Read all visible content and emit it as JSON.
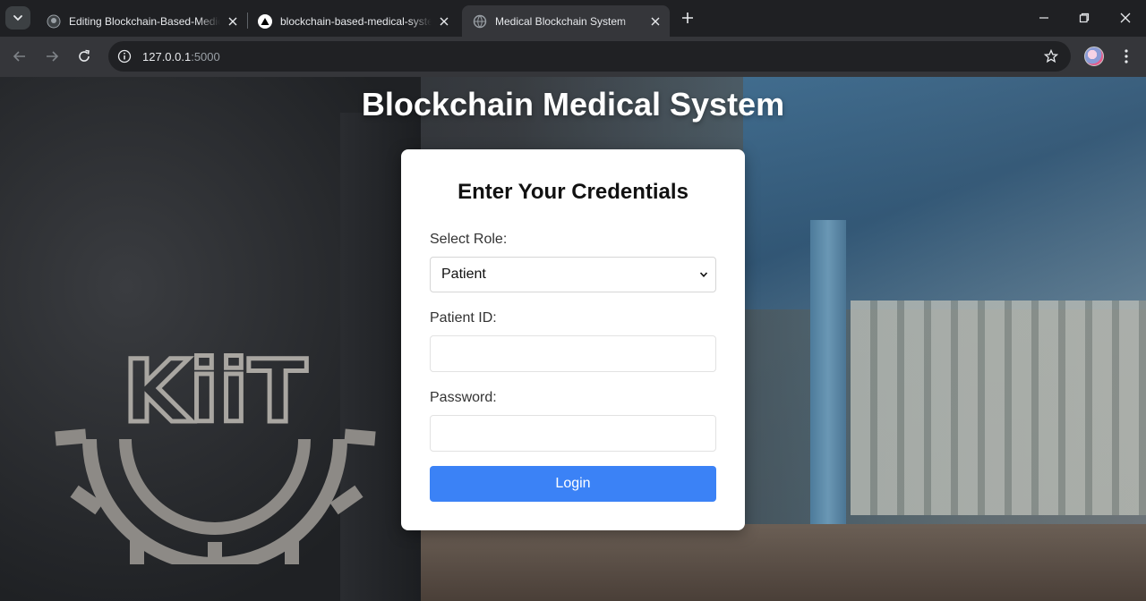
{
  "browser": {
    "tabs": [
      {
        "title": "Editing Blockchain-Based-Medical-System",
        "favicon": "github-icon",
        "active": false
      },
      {
        "title": "blockchain-based-medical-system",
        "favicon": "vercel-icon",
        "active": false
      },
      {
        "title": "Medical Blockchain System",
        "favicon": "globe-icon",
        "active": true
      }
    ],
    "url_host": "127.0.0.1",
    "url_port": ":5000"
  },
  "page": {
    "title": "Blockchain Medical System",
    "logo_text": "KiiT"
  },
  "login_card": {
    "title": "Enter Your Credentials",
    "role_label": "Select Role:",
    "role_value": "Patient",
    "id_label": "Patient ID:",
    "password_label": "Password:",
    "login_button": "Login"
  },
  "colors": {
    "accent": "#3b82f6"
  }
}
